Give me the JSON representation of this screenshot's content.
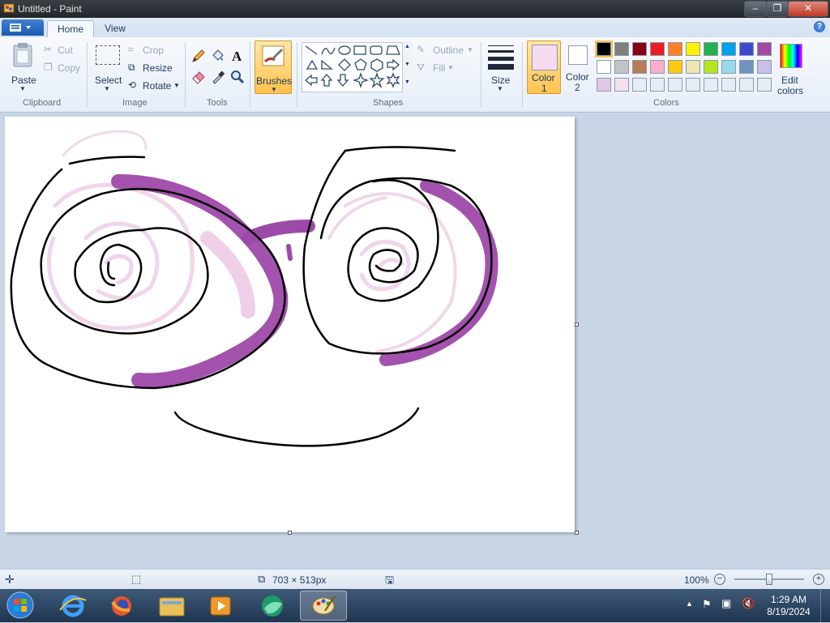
{
  "window": {
    "title": "Untitled - Paint",
    "controls": {
      "minimize": "–",
      "maximize": "❐",
      "close": "✕"
    }
  },
  "tabs": {
    "home": "Home",
    "view": "View"
  },
  "help": "?",
  "ribbon": {
    "clipboard": {
      "label": "Clipboard",
      "paste": "Paste",
      "cut": "Cut",
      "copy": "Copy"
    },
    "image": {
      "label": "Image",
      "select": "Select",
      "crop": "Crop",
      "resize": "Resize",
      "rotate": "Rotate"
    },
    "tools": {
      "label": "Tools"
    },
    "brushes": {
      "label": "Brushes"
    },
    "shapes": {
      "label": "Shapes",
      "outline": "Outline",
      "fill": "Fill"
    },
    "size": {
      "label": "Size"
    },
    "colors": {
      "label": "Colors",
      "color1": "Color",
      "color1_num": "1",
      "color2": "Color",
      "color2_num": "2",
      "edit": "Edit",
      "edit2": "colors",
      "color1_value": "#f5dbef",
      "color2_value": "#ffffff",
      "palette_row1": [
        "#000000",
        "#7f7f7f",
        "#880015",
        "#ed1c24",
        "#ff7f27",
        "#fff200",
        "#22b14c",
        "#00a2e8",
        "#3f48cc",
        "#a349a4"
      ],
      "palette_row2": [
        "#ffffff",
        "#c3c3c3",
        "#b97a57",
        "#ffaec9",
        "#ffc90e",
        "#efe4b0",
        "#b5e61d",
        "#99d9ea",
        "#7092be",
        "#c8bfe7"
      ],
      "palette_row3": [
        "#e3c8e6",
        "#f4e1f0",
        "#e6ecf4",
        "#e6ecf4",
        "#e6ecf4",
        "#e6ecf4",
        "#e6ecf4",
        "#e6ecf4",
        "#e6ecf4",
        "#e6ecf4"
      ]
    }
  },
  "status": {
    "canvas_size": "703 × 513px",
    "zoom": "100%",
    "zoom_level": 0.5
  },
  "tray": {
    "time": "1:29 AM",
    "date": "8/19/2024"
  }
}
